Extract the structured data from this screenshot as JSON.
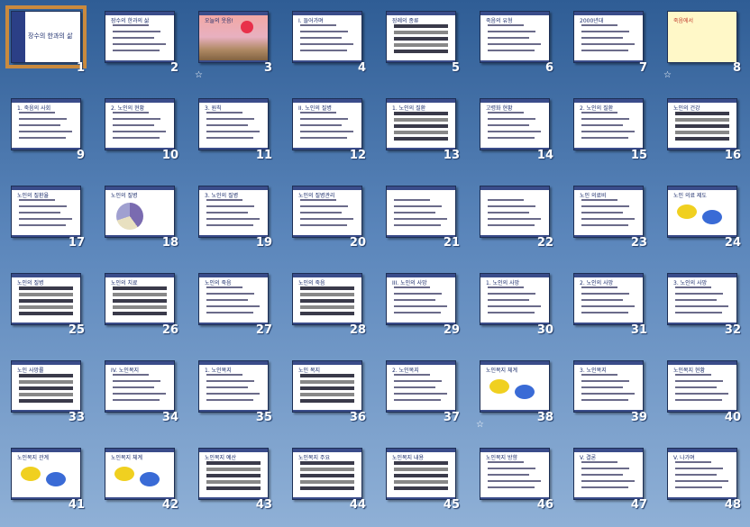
{
  "slides": [
    {
      "number": "1",
      "kind": "title",
      "title": "장수의 한과의 삶",
      "selected": true
    },
    {
      "number": "2",
      "kind": "text",
      "title": "장수의 한과의 삶"
    },
    {
      "number": "3",
      "kind": "image",
      "title": "오늘의 웃음!",
      "transition": true
    },
    {
      "number": "4",
      "kind": "text",
      "title": "I. 들어가며"
    },
    {
      "number": "5",
      "kind": "table",
      "title": "장례의 종류"
    },
    {
      "number": "6",
      "kind": "text",
      "title": "죽음의 유형"
    },
    {
      "number": "7",
      "kind": "text",
      "title": "2000년대"
    },
    {
      "number": "8",
      "kind": "yellow",
      "title": "죽음에서",
      "transition": true
    },
    {
      "number": "9",
      "kind": "text",
      "title": "1. 죽음의 사회"
    },
    {
      "number": "10",
      "kind": "text",
      "title": "2. 노인의 현황"
    },
    {
      "number": "11",
      "kind": "text",
      "title": "3. 원칙"
    },
    {
      "number": "12",
      "kind": "text",
      "title": "II. 노인의 질병"
    },
    {
      "number": "13",
      "kind": "bars",
      "title": "1. 노인의 질환"
    },
    {
      "number": "14",
      "kind": "chart",
      "title": "고령화 현황"
    },
    {
      "number": "15",
      "kind": "line",
      "title": "2. 노인의 질환"
    },
    {
      "number": "16",
      "kind": "table",
      "title": "노인의 건강"
    },
    {
      "number": "17",
      "kind": "line",
      "title": "노인의 질환율"
    },
    {
      "number": "18",
      "kind": "pie",
      "title": "노인의 질병"
    },
    {
      "number": "19",
      "kind": "text",
      "title": "3. 노인의 질병"
    },
    {
      "number": "20",
      "kind": "text",
      "title": "노인의 질병관리"
    },
    {
      "number": "21",
      "kind": "image",
      "title": ""
    },
    {
      "number": "22",
      "kind": "text",
      "title": ""
    },
    {
      "number": "23",
      "kind": "image",
      "title": "노인 의료비"
    },
    {
      "number": "24",
      "kind": "diagram",
      "title": "노인 의료 제도"
    },
    {
      "number": "25",
      "kind": "table",
      "title": "노인의 질병"
    },
    {
      "number": "26",
      "kind": "table",
      "title": "노인의 치료"
    },
    {
      "number": "27",
      "kind": "text",
      "title": "노인의 죽음"
    },
    {
      "number": "28",
      "kind": "bars",
      "title": "노인의 죽음"
    },
    {
      "number": "29",
      "kind": "text",
      "title": "III. 노인의 사망"
    },
    {
      "number": "30",
      "kind": "text",
      "title": "1. 노인의 사망"
    },
    {
      "number": "31",
      "kind": "text",
      "title": "2. 노인의 사망"
    },
    {
      "number": "32",
      "kind": "text",
      "title": "3. 노인의 사망"
    },
    {
      "number": "33",
      "kind": "table",
      "title": "노인 사망률"
    },
    {
      "number": "34",
      "kind": "text",
      "title": "IV. 노인복지"
    },
    {
      "number": "35",
      "kind": "text",
      "title": "1. 노인복지"
    },
    {
      "number": "36",
      "kind": "table",
      "title": "노인 복지"
    },
    {
      "number": "37",
      "kind": "text",
      "title": "2. 노인복지"
    },
    {
      "number": "38",
      "kind": "diagram",
      "title": "노인복지 체계",
      "transition": true
    },
    {
      "number": "39",
      "kind": "text",
      "title": "3. 노인복지"
    },
    {
      "number": "40",
      "kind": "line",
      "title": "노인복지 현황"
    },
    {
      "number": "41",
      "kind": "diagram",
      "title": "노인복지 관계"
    },
    {
      "number": "42",
      "kind": "diagram",
      "title": "노인복지 체계"
    },
    {
      "number": "43",
      "kind": "bars",
      "title": "노인복지 예산"
    },
    {
      "number": "44",
      "kind": "bars",
      "title": "노인복지 주요"
    },
    {
      "number": "45",
      "kind": "table",
      "title": "노인복지 내용"
    },
    {
      "number": "46",
      "kind": "text",
      "title": "노인복지 방향"
    },
    {
      "number": "47",
      "kind": "text",
      "title": "V. 결론"
    },
    {
      "number": "48",
      "kind": "text",
      "title": "V. 나가며"
    }
  ],
  "icons": {
    "transition": "star-outline-icon"
  },
  "colors": {
    "background": "#4a77ad",
    "selection": "#c98a3e",
    "title_bar": "#3a4c8a"
  }
}
